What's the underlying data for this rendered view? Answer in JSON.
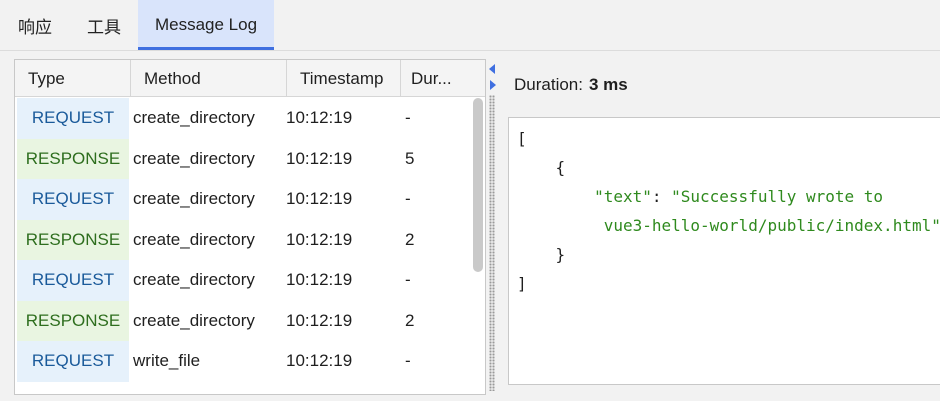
{
  "tabs": [
    {
      "label": "响应",
      "active": false
    },
    {
      "label": "工具",
      "active": false
    },
    {
      "label": "Message Log",
      "active": true
    }
  ],
  "table": {
    "headers": [
      "Type",
      "Method",
      "Timestamp",
      "Dur..."
    ],
    "rows": [
      {
        "type": "REQUEST",
        "method": "create_directory",
        "timestamp": "10:12:19",
        "duration": "-"
      },
      {
        "type": "RESPONSE",
        "method": "create_directory",
        "timestamp": "10:12:19",
        "duration": "5"
      },
      {
        "type": "REQUEST",
        "method": "create_directory",
        "timestamp": "10:12:19",
        "duration": "-"
      },
      {
        "type": "RESPONSE",
        "method": "create_directory",
        "timestamp": "10:12:19",
        "duration": "2"
      },
      {
        "type": "REQUEST",
        "method": "create_directory",
        "timestamp": "10:12:19",
        "duration": "-"
      },
      {
        "type": "RESPONSE",
        "method": "create_directory",
        "timestamp": "10:12:19",
        "duration": "2"
      },
      {
        "type": "REQUEST",
        "method": "write_file",
        "timestamp": "10:12:19",
        "duration": "-"
      }
    ]
  },
  "detail": {
    "duration_label": "Duration:",
    "duration_value": "3 ms",
    "json_lines": {
      "open_bracket": "[",
      "open_brace": "{",
      "key": "\"text\"",
      "colon": ": ",
      "value_part1": "\"Successfully wrote to",
      "value_part2": "vue3-hello-world/public/index.html\"",
      "close_brace": "}",
      "close_bracket": "]"
    }
  },
  "colors": {
    "accent": "#3f6fe0",
    "active_tab_bg": "#d9e4fb",
    "request_bg": "#e6f1fb",
    "request_text": "#1a5a9a",
    "response_bg": "#e9f5e1",
    "response_text": "#2e6e1e",
    "json_string": "#2f8a1e"
  }
}
